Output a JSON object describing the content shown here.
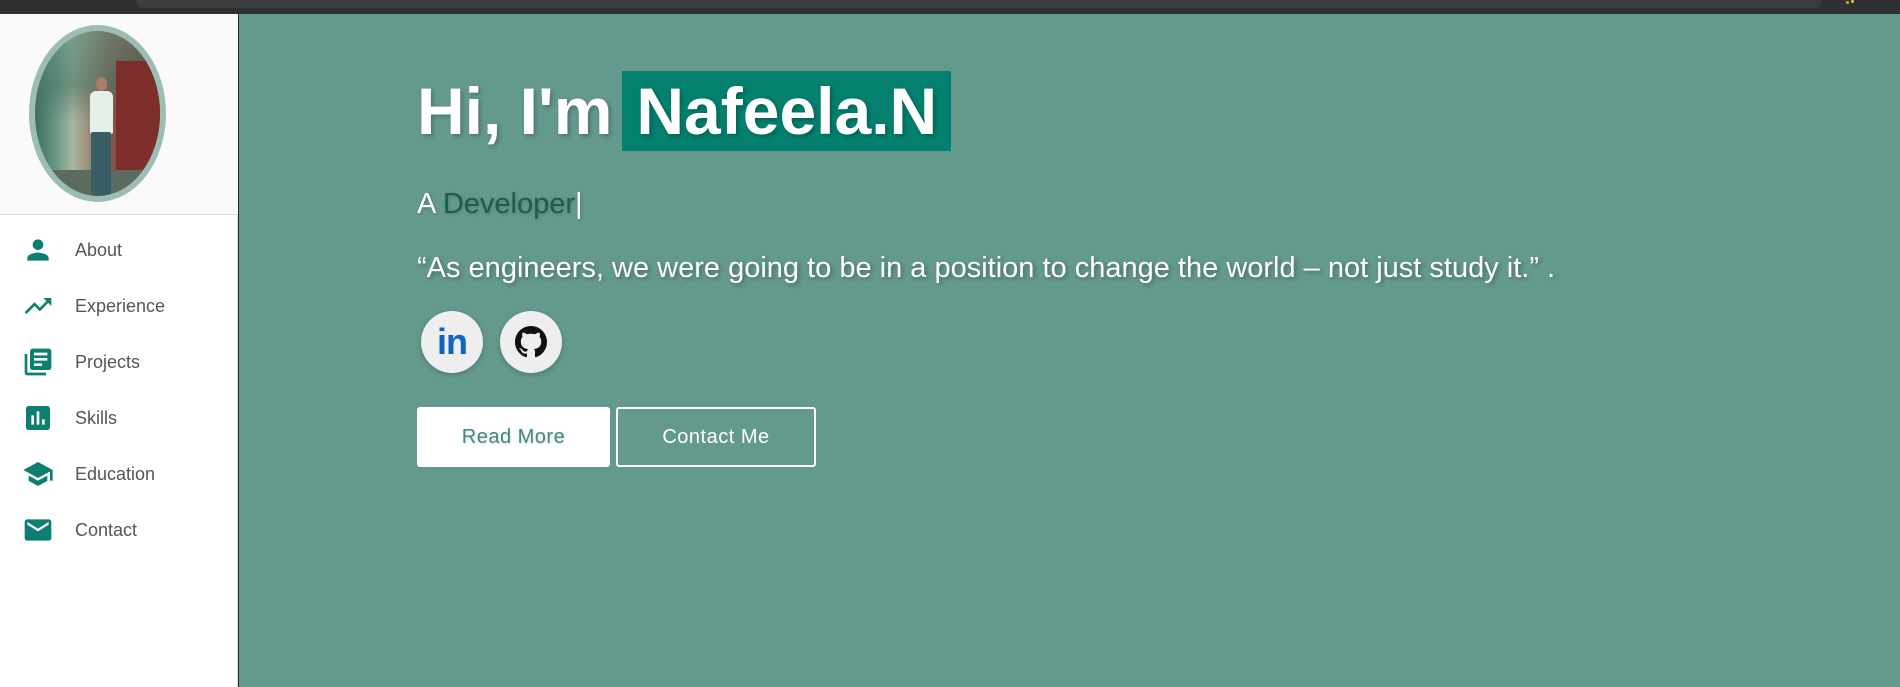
{
  "sidebar": {
    "profile": {
      "photo_icon": "profile-photo"
    },
    "items": [
      {
        "label": "About",
        "icon": "person-icon"
      },
      {
        "label": "Experience",
        "icon": "trending-up-icon"
      },
      {
        "label": "Projects",
        "icon": "library-books-icon"
      },
      {
        "label": "Skills",
        "icon": "bar-chart-icon"
      },
      {
        "label": "Education",
        "icon": "graduation-cap-icon"
      },
      {
        "label": "Contact",
        "icon": "mail-icon"
      }
    ]
  },
  "hero": {
    "greeting_prefix": "Hi, I'm",
    "name": "Nafeela.N",
    "role_prefix": "A",
    "role_typed": "Developer",
    "role_cursor": "|",
    "quote": "“As engineers, we were going to be in a position to change the world – not just study it.” .",
    "socials": [
      {
        "name": "linkedin",
        "text": "in"
      },
      {
        "name": "github"
      }
    ],
    "buttons": {
      "read_more": "Read More",
      "contact_me": "Contact Me"
    }
  },
  "colors": {
    "main_bg": "#64998d",
    "accent": "#03806e",
    "sidebar_icon": "#0d7f71",
    "nav_text": "#555555",
    "typed_text": "#1f5b4e",
    "linkedin_blue": "#0a66c2"
  }
}
